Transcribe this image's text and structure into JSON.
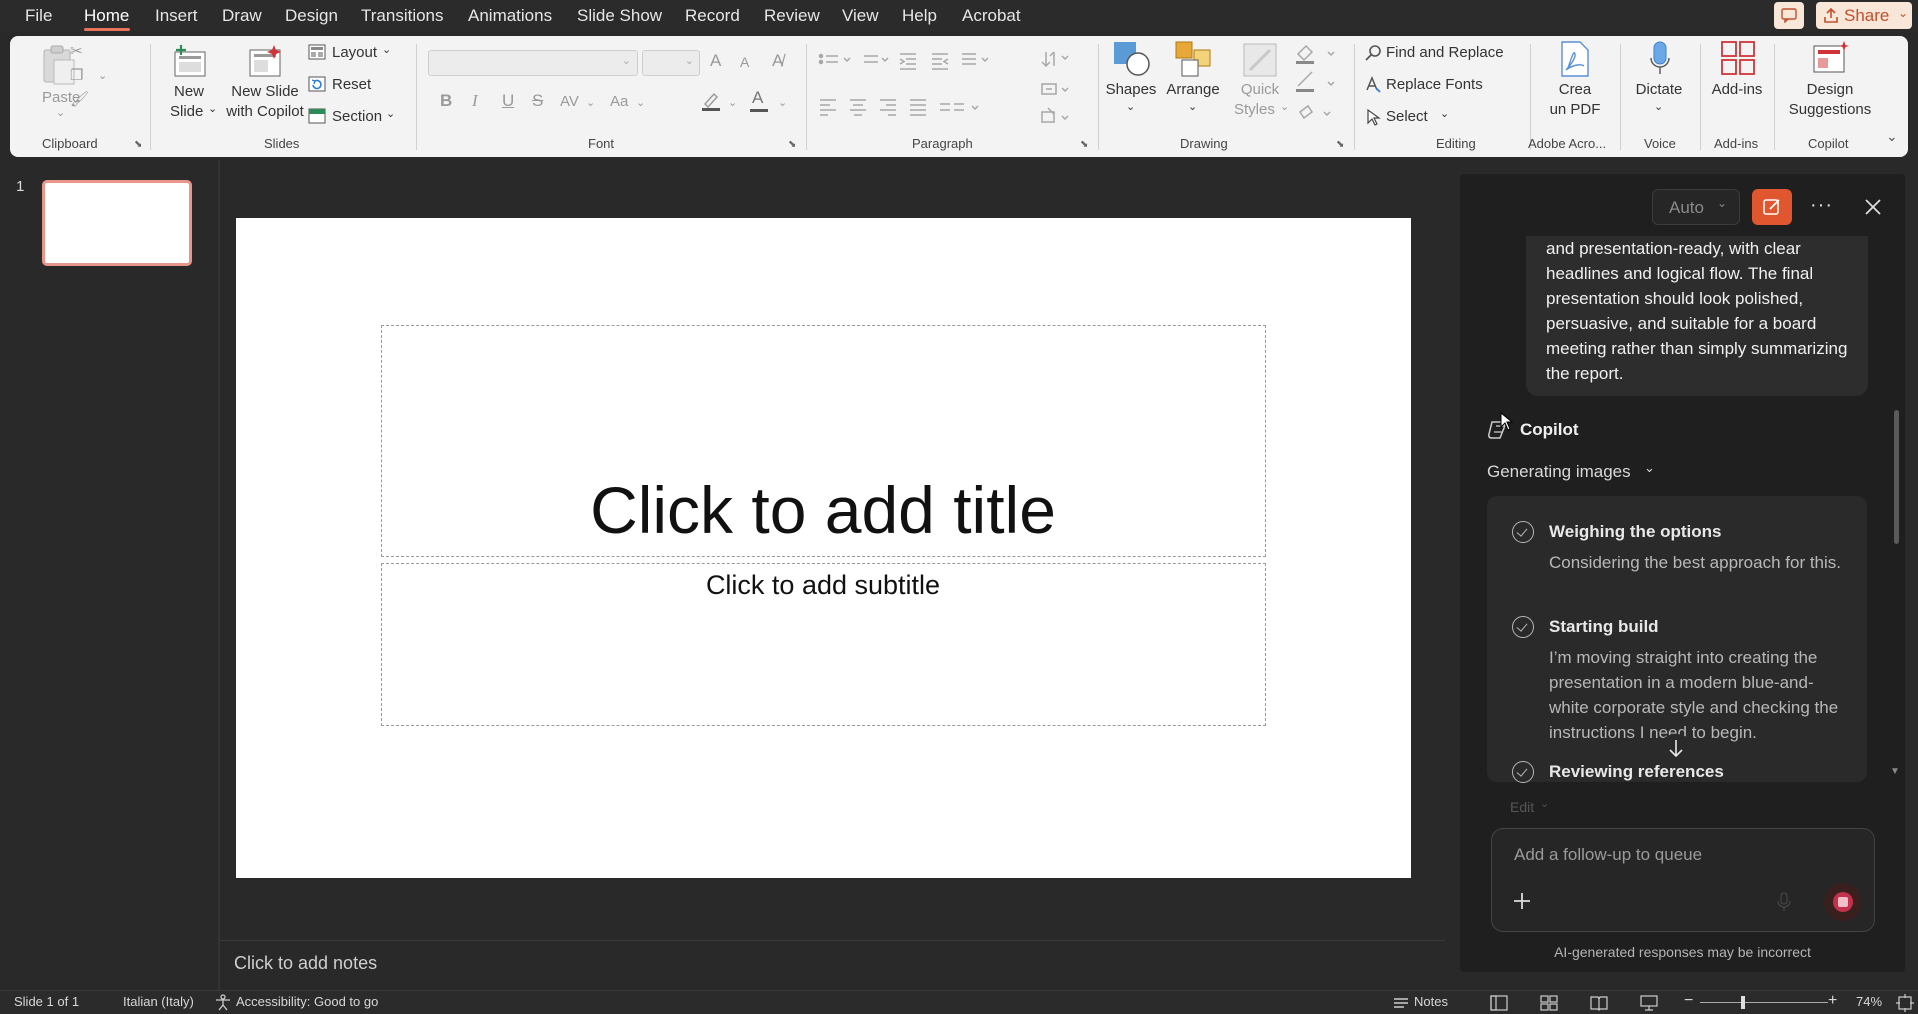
{
  "menu": {
    "items": [
      "File",
      "Home",
      "Insert",
      "Draw",
      "Design",
      "Transitions",
      "Animations",
      "Slide Show",
      "Record",
      "Review",
      "View",
      "Help",
      "Acrobat"
    ],
    "share_label": "Share"
  },
  "ribbon": {
    "clipboard": {
      "paste": "Paste",
      "group": "Clipboard"
    },
    "slides": {
      "new_slide_line1": "New",
      "new_slide_line2": "Slide",
      "new_copilot_line1": "New Slide",
      "new_copilot_line2": "with Copilot",
      "layout": "Layout",
      "reset": "Reset",
      "section": "Section",
      "group": "Slides"
    },
    "font": {
      "group": "Font",
      "bold": "B",
      "italic": "I",
      "underline": "U",
      "strike": "S",
      "spacing": "AV",
      "case": "Aa",
      "grow": "A",
      "shrink": "A"
    },
    "paragraph": {
      "group": "Paragraph"
    },
    "drawing": {
      "shapes": "Shapes",
      "arrange": "Arrange",
      "quick_line1": "Quick",
      "quick_line2": "Styles",
      "group": "Drawing"
    },
    "editing": {
      "find": "Find and Replace",
      "replace_fonts": "Replace Fonts",
      "select": "Select",
      "group": "Editing"
    },
    "adobe": {
      "line1": "Crea",
      "line2": "un PDF",
      "group": "Adobe Acro..."
    },
    "voice": {
      "dictate": "Dictate",
      "group": "Voice"
    },
    "addins": {
      "label": "Add-ins",
      "group": "Add-ins"
    },
    "copilot": {
      "line1": "Design",
      "line2": "Suggestions",
      "group": "Copilot"
    }
  },
  "thumbnails": {
    "slide_number": "1"
  },
  "slide": {
    "title_placeholder": "Click to add title",
    "subtitle_placeholder": "Click to add subtitle"
  },
  "notes": {
    "placeholder": "Click to add notes"
  },
  "copilot_pane": {
    "mode": "Auto",
    "user_message": "and presentation-ready, with clear headlines and logical flow. The final presentation should look polished, persuasive, and suitable for a board meeting rather than simply summarizing the report.",
    "assistant_name": "Copilot",
    "status": "Generating images",
    "steps": [
      {
        "title": "Weighing the options",
        "desc": "Considering the best approach for this."
      },
      {
        "title": "Starting build",
        "desc": "I’m moving straight into creating the presentation in a modern blue-and-white corporate style and checking the instructions I need to begin."
      },
      {
        "title": "Reviewing references",
        "desc": ""
      }
    ],
    "edit_label": "Edit",
    "input_placeholder": "Add a follow-up to queue",
    "disclaimer": "AI-generated responses may be incorrect"
  },
  "status": {
    "slide_info": "Slide 1 of 1",
    "language": "Italian (Italy)",
    "accessibility": "Accessibility: Good to go",
    "notes": "Notes",
    "zoom": "74%"
  },
  "colors": {
    "accent": "#e8745a",
    "record": "#c4314b",
    "app_bg": "#292929",
    "ribbon_bg": "#f3f3f3"
  }
}
